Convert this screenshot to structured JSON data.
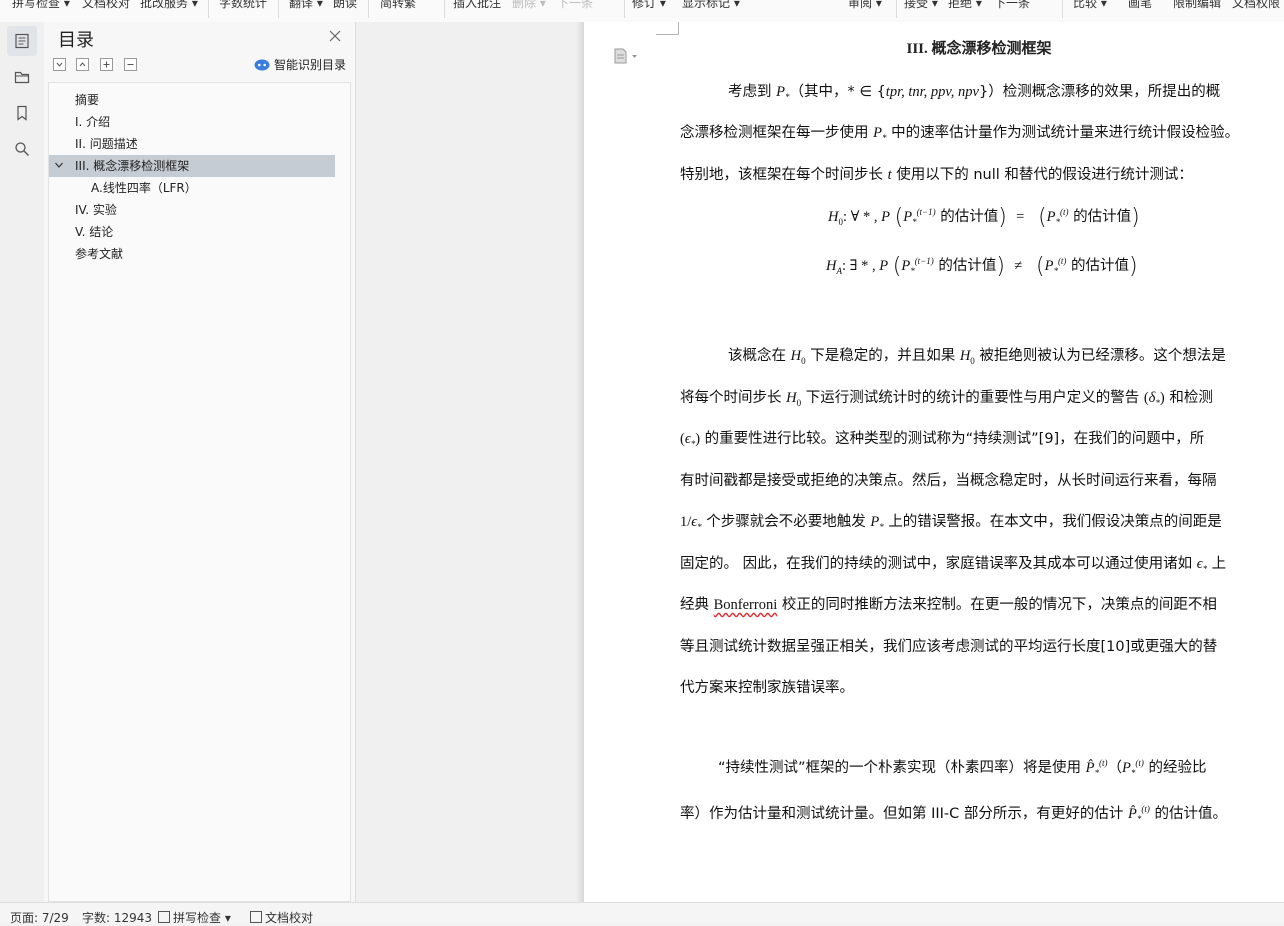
{
  "ribbon": {
    "items": [
      {
        "label": "拼写检查 ▾",
        "dim": false
      },
      {
        "label": "文档校对",
        "dim": false
      },
      {
        "label": "批改服务 ▾",
        "dim": false
      },
      {
        "label": "字数统计",
        "dim": false
      },
      {
        "label": "翻译 ▾",
        "dim": false
      },
      {
        "label": "朗读",
        "dim": false
      },
      {
        "label": "简转繁",
        "dim": false
      },
      {
        "label": "插入批注",
        "dim": false
      },
      {
        "label": "删除 ▾",
        "dim": true
      },
      {
        "label": "下一条",
        "dim": true
      },
      {
        "label": "修订 ▾",
        "dim": false
      },
      {
        "label": "显示标记 ▾",
        "dim": false
      },
      {
        "label": "审阅 ▾",
        "dim": false
      },
      {
        "label": "接受 ▾",
        "dim": false
      },
      {
        "label": "拒绝 ▾",
        "dim": false
      },
      {
        "label": "下一条",
        "dim": false
      },
      {
        "label": "比较 ▾",
        "dim": false
      },
      {
        "label": "画笔",
        "dim": false
      },
      {
        "label": "限制编辑",
        "dim": false
      },
      {
        "label": "文档权限",
        "dim": false
      }
    ]
  },
  "toc": {
    "title": "目录",
    "smart_label": "智能识别目录",
    "items": [
      {
        "label": "摘要"
      },
      {
        "label": "I.  介绍"
      },
      {
        "label": "II.  问题描述"
      },
      {
        "label": "III.  概念漂移检测框架"
      },
      {
        "label": "A.线性四率（LFR）"
      },
      {
        "label": "IV.  实验"
      },
      {
        "label": "V.  结论"
      },
      {
        "label": "参考文献"
      }
    ]
  },
  "doc": {
    "heading": "III.   概念漂移检测框架",
    "p1": [
      "考虑到",
      "（其中，* ∈ {",
      "tpr, tnr, ppv, npv",
      "}）检测概念漂移的效果，所提出的概",
      "念漂移检测框架在每一步使用",
      "中的速率估计量作为测试统计量来进行统计假设检验。",
      "特别地，该框架在每个时间步长",
      "使用以下的 null 和替代的假设进行统计测试："
    ],
    "eq": {
      "h0_prefix": ": ∀ * , ",
      "h1_prefix": ": ∃ * , ",
      "est": "的估计值",
      "eq_sign": "=",
      "neq_sign": "≠",
      "tm1": "(t−1)",
      "t": "(t)"
    },
    "p2": [
      "该概念在",
      "下是稳定的，并且如果",
      "被拒绝则被认为已经漂移。这个想法是",
      "将每个时间步长",
      "下运行测试统计时的统计的重要性与用户定义的警告",
      "和检测",
      "的重要性进行比较。这种类型的测试称为“持续测试”[9]，在我们的问题中，所",
      "有时间戳都是接受或拒绝的决策点。然后，当概念稳定时，从长时间运行来看，每隔",
      "1/",
      "个步骤就会不必要地触发",
      "上的错误警报。在本文中，我们假设决策点的间距是",
      "固定的。 因此，在我们的持续的测试中，家庭错误率及其成本可以通过使用诸如",
      "上",
      "经典",
      "Bonferroni",
      "校正的同时推断方法来控制。在更一般的情况下，决策点的间距不相",
      "等且测试统计数据呈强正相关，我们应该考虑测试的平均运行长度[10]或更强大的替",
      "代方案来控制家族错误率。"
    ],
    "p3": [
      "“持续性测试”框架的一个朴素实现（朴素四率）将是使用",
      "（",
      "的经验比",
      "率）作为估计量和测试统计量。但如第 III-C 部分所示，有更好的估计",
      "的估计值。"
    ]
  },
  "status": {
    "page": "页面: 7/29",
    "words": "字数: 12943",
    "spell": "拼写检查 ▾",
    "proof": "文档校对"
  }
}
